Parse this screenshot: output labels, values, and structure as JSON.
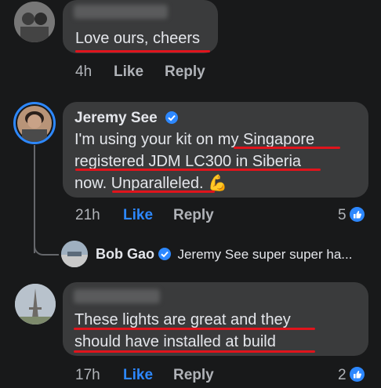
{
  "comments": [
    {
      "author": "Jeremy See",
      "text_html_parts": [
        "I'm using your kit on my Singapore",
        "registered JDM LC300 in Siberia",
        "now. Unparalleled. "
      ],
      "emoji": "💪",
      "time": "21h",
      "like_label": "Like",
      "reply_label": "Reply",
      "reactions": "5"
    },
    {
      "text_lines": [
        "These lights are great and they",
        "should have installed   at build"
      ],
      "time": "17h",
      "like_label": "Like",
      "reply_label": "Reply",
      "reactions": "2"
    }
  ],
  "top_comment": {
    "text": "Love ours, cheers",
    "time": "4h",
    "like_label": "Like",
    "reply_label": "Reply"
  },
  "reply_preview": {
    "author": "Bob Gao",
    "snippet": "Jeremy See super super  ha..."
  },
  "icons": {
    "verified": "verified-badge-icon",
    "like": "like-thumb-icon"
  },
  "colors": {
    "background": "#18191a",
    "bubble": "#3a3b3c",
    "accent": "#2d88ff",
    "annotation": "#e0141c"
  }
}
